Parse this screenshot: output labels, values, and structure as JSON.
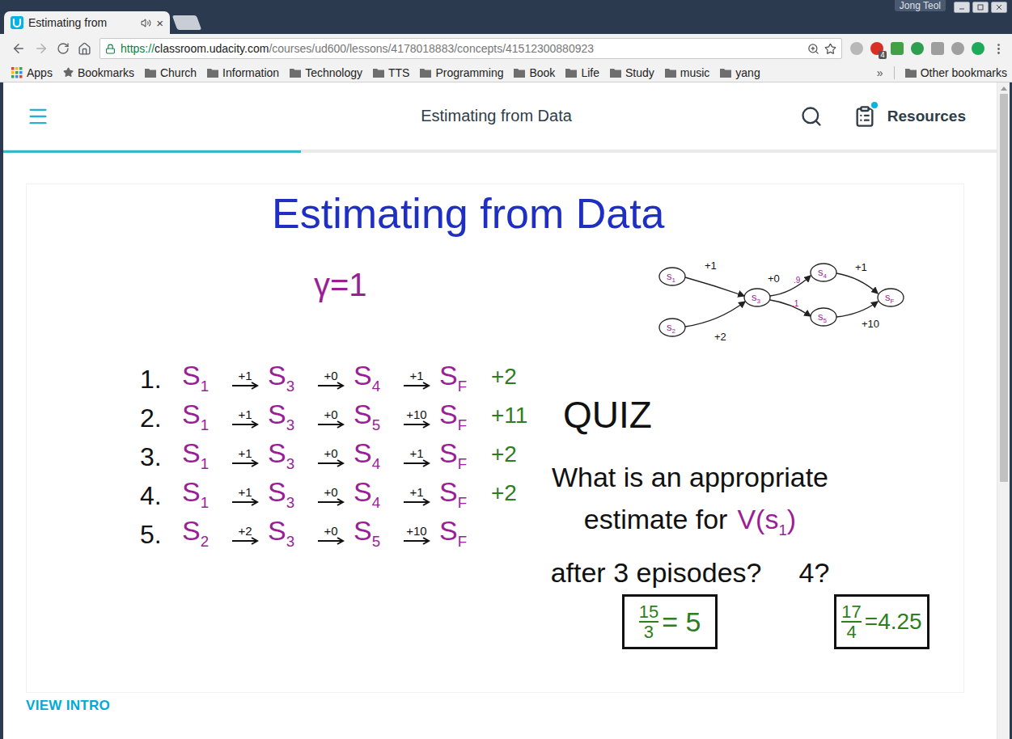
{
  "browser": {
    "tab": {
      "title": "Estimating from",
      "close": "×",
      "audio": true
    },
    "profile": "Jong Teol",
    "url": {
      "scheme": "https://",
      "host": "classroom.udacity.com",
      "path": "/courses/ud600/lessons/4178018883/concepts/41512300880923"
    },
    "extension_badge": "4",
    "bookmarks": [
      {
        "label": "Apps",
        "kind": "apps"
      },
      {
        "label": "Bookmarks",
        "kind": "star"
      },
      {
        "label": "Church",
        "kind": "folder"
      },
      {
        "label": "Information",
        "kind": "folder"
      },
      {
        "label": "Technology",
        "kind": "folder"
      },
      {
        "label": "TTS",
        "kind": "folder"
      },
      {
        "label": "Programming",
        "kind": "folder"
      },
      {
        "label": "Book",
        "kind": "folder"
      },
      {
        "label": "Life",
        "kind": "folder"
      },
      {
        "label": "Study",
        "kind": "folder"
      },
      {
        "label": "music",
        "kind": "folder"
      },
      {
        "label": "yang",
        "kind": "folder"
      }
    ],
    "bookmarks_overflow": "»",
    "other_bookmarks": "Other bookmarks"
  },
  "page": {
    "title": "Estimating from Data",
    "resources": "Resources",
    "resources_badge": true,
    "progress": 0.3,
    "view_intro": "VIEW INTRO"
  },
  "whiteboard": {
    "title": "Estimating from Data",
    "gamma": "γ=1",
    "graph": {
      "nodes": [
        {
          "letter": "s",
          "sub": "1"
        },
        {
          "letter": "s",
          "sub": "2"
        },
        {
          "letter": "s",
          "sub": "3"
        },
        {
          "letter": "s",
          "sub": "4"
        },
        {
          "letter": "s",
          "sub": "5"
        },
        {
          "letter": "s",
          "sub": "F"
        }
      ],
      "edges": [
        {
          "from": 0,
          "to": 2,
          "reward": "+1"
        },
        {
          "from": 1,
          "to": 2,
          "reward": "+2"
        },
        {
          "from": 2,
          "to": 3,
          "reward": "+0",
          "prob": ".9"
        },
        {
          "from": 2,
          "to": 4,
          "prob": ".1"
        },
        {
          "from": 3,
          "to": 5,
          "reward": "+1"
        },
        {
          "from": 4,
          "to": 5,
          "reward": "+10"
        }
      ]
    },
    "episodes": [
      {
        "number": "1.",
        "states": [
          {
            "letter": "S",
            "sub": "1"
          },
          {
            "letter": "S",
            "sub": "3"
          },
          {
            "letter": "S",
            "sub": "4"
          },
          {
            "letter": "S",
            "sub": "F"
          }
        ],
        "rewards": [
          "+1",
          "+0",
          "+1"
        ],
        "total": "+2"
      },
      {
        "number": "2.",
        "states": [
          {
            "letter": "S",
            "sub": "1"
          },
          {
            "letter": "S",
            "sub": "3"
          },
          {
            "letter": "S",
            "sub": "5"
          },
          {
            "letter": "S",
            "sub": "F"
          }
        ],
        "rewards": [
          "+1",
          "+0",
          "+10"
        ],
        "total": "+11"
      },
      {
        "number": "3.",
        "states": [
          {
            "letter": "S",
            "sub": "1"
          },
          {
            "letter": "S",
            "sub": "3"
          },
          {
            "letter": "S",
            "sub": "4"
          },
          {
            "letter": "S",
            "sub": "F"
          }
        ],
        "rewards": [
          "+1",
          "+0",
          "+1"
        ],
        "total": "+2"
      },
      {
        "number": "4.",
        "states": [
          {
            "letter": "S",
            "sub": "1"
          },
          {
            "letter": "S",
            "sub": "3"
          },
          {
            "letter": "S",
            "sub": "4"
          },
          {
            "letter": "S",
            "sub": "F"
          }
        ],
        "rewards": [
          "+1",
          "+0",
          "+1"
        ],
        "total": "+2"
      },
      {
        "number": "5.",
        "states": [
          {
            "letter": "S",
            "sub": "2"
          },
          {
            "letter": "S",
            "sub": "3"
          },
          {
            "letter": "S",
            "sub": "5"
          },
          {
            "letter": "S",
            "sub": "F"
          }
        ],
        "rewards": [
          "+2",
          "+0",
          "+10"
        ]
      }
    ],
    "quiz": {
      "heading": "QUIZ",
      "lines": [
        {
          "text": "What is an appropriate"
        },
        {
          "text": "estimate for",
          "value": {
            "pre": "V(s",
            "sub": "1",
            "post": ")"
          }
        },
        {
          "text": "after 3 episodes?",
          "guess": "4?"
        }
      ]
    },
    "answers": [
      {
        "num": "15",
        "den": "3",
        "result": "= 5"
      },
      {
        "num": "17",
        "den": "4",
        "result": "=4.25"
      }
    ]
  }
}
